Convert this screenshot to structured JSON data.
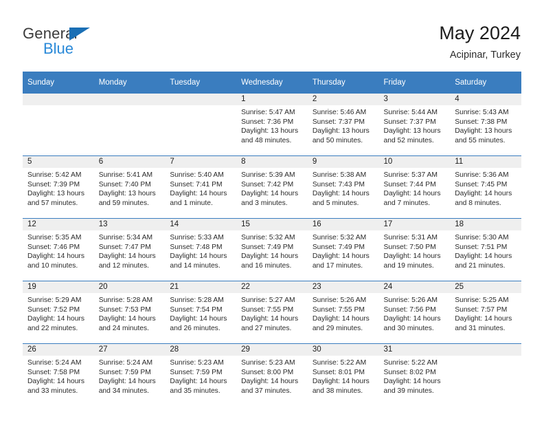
{
  "brand": {
    "name_top": "General",
    "name_bottom": "Blue",
    "triangle_color": "#1a6fb5",
    "blue_text_color": "#2989d8"
  },
  "header": {
    "title": "May 2024",
    "subtitle": "Acipinar, Turkey",
    "accent_color": "#3a7dbf",
    "daynum_band_color": "#efefef"
  },
  "calendar": {
    "weekday_headers": [
      "Sunday",
      "Monday",
      "Tuesday",
      "Wednesday",
      "Thursday",
      "Friday",
      "Saturday"
    ],
    "labels": {
      "sunrise": "Sunrise:",
      "sunset": "Sunset:",
      "daylight": "Daylight:"
    },
    "weeks": [
      [
        {
          "day": "",
          "empty": true
        },
        {
          "day": "",
          "empty": true
        },
        {
          "day": "",
          "empty": true
        },
        {
          "day": "1",
          "sunrise": "Sunrise: 5:47 AM",
          "sunset": "Sunset: 7:36 PM",
          "daylight1": "Daylight: 13 hours",
          "daylight2": "and 48 minutes."
        },
        {
          "day": "2",
          "sunrise": "Sunrise: 5:46 AM",
          "sunset": "Sunset: 7:37 PM",
          "daylight1": "Daylight: 13 hours",
          "daylight2": "and 50 minutes."
        },
        {
          "day": "3",
          "sunrise": "Sunrise: 5:44 AM",
          "sunset": "Sunset: 7:37 PM",
          "daylight1": "Daylight: 13 hours",
          "daylight2": "and 52 minutes."
        },
        {
          "day": "4",
          "sunrise": "Sunrise: 5:43 AM",
          "sunset": "Sunset: 7:38 PM",
          "daylight1": "Daylight: 13 hours",
          "daylight2": "and 55 minutes."
        }
      ],
      [
        {
          "day": "5",
          "sunrise": "Sunrise: 5:42 AM",
          "sunset": "Sunset: 7:39 PM",
          "daylight1": "Daylight: 13 hours",
          "daylight2": "and 57 minutes."
        },
        {
          "day": "6",
          "sunrise": "Sunrise: 5:41 AM",
          "sunset": "Sunset: 7:40 PM",
          "daylight1": "Daylight: 13 hours",
          "daylight2": "and 59 minutes."
        },
        {
          "day": "7",
          "sunrise": "Sunrise: 5:40 AM",
          "sunset": "Sunset: 7:41 PM",
          "daylight1": "Daylight: 14 hours",
          "daylight2": "and 1 minute."
        },
        {
          "day": "8",
          "sunrise": "Sunrise: 5:39 AM",
          "sunset": "Sunset: 7:42 PM",
          "daylight1": "Daylight: 14 hours",
          "daylight2": "and 3 minutes."
        },
        {
          "day": "9",
          "sunrise": "Sunrise: 5:38 AM",
          "sunset": "Sunset: 7:43 PM",
          "daylight1": "Daylight: 14 hours",
          "daylight2": "and 5 minutes."
        },
        {
          "day": "10",
          "sunrise": "Sunrise: 5:37 AM",
          "sunset": "Sunset: 7:44 PM",
          "daylight1": "Daylight: 14 hours",
          "daylight2": "and 7 minutes."
        },
        {
          "day": "11",
          "sunrise": "Sunrise: 5:36 AM",
          "sunset": "Sunset: 7:45 PM",
          "daylight1": "Daylight: 14 hours",
          "daylight2": "and 8 minutes."
        }
      ],
      [
        {
          "day": "12",
          "sunrise": "Sunrise: 5:35 AM",
          "sunset": "Sunset: 7:46 PM",
          "daylight1": "Daylight: 14 hours",
          "daylight2": "and 10 minutes."
        },
        {
          "day": "13",
          "sunrise": "Sunrise: 5:34 AM",
          "sunset": "Sunset: 7:47 PM",
          "daylight1": "Daylight: 14 hours",
          "daylight2": "and 12 minutes."
        },
        {
          "day": "14",
          "sunrise": "Sunrise: 5:33 AM",
          "sunset": "Sunset: 7:48 PM",
          "daylight1": "Daylight: 14 hours",
          "daylight2": "and 14 minutes."
        },
        {
          "day": "15",
          "sunrise": "Sunrise: 5:32 AM",
          "sunset": "Sunset: 7:49 PM",
          "daylight1": "Daylight: 14 hours",
          "daylight2": "and 16 minutes."
        },
        {
          "day": "16",
          "sunrise": "Sunrise: 5:32 AM",
          "sunset": "Sunset: 7:49 PM",
          "daylight1": "Daylight: 14 hours",
          "daylight2": "and 17 minutes."
        },
        {
          "day": "17",
          "sunrise": "Sunrise: 5:31 AM",
          "sunset": "Sunset: 7:50 PM",
          "daylight1": "Daylight: 14 hours",
          "daylight2": "and 19 minutes."
        },
        {
          "day": "18",
          "sunrise": "Sunrise: 5:30 AM",
          "sunset": "Sunset: 7:51 PM",
          "daylight1": "Daylight: 14 hours",
          "daylight2": "and 21 minutes."
        }
      ],
      [
        {
          "day": "19",
          "sunrise": "Sunrise: 5:29 AM",
          "sunset": "Sunset: 7:52 PM",
          "daylight1": "Daylight: 14 hours",
          "daylight2": "and 22 minutes."
        },
        {
          "day": "20",
          "sunrise": "Sunrise: 5:28 AM",
          "sunset": "Sunset: 7:53 PM",
          "daylight1": "Daylight: 14 hours",
          "daylight2": "and 24 minutes."
        },
        {
          "day": "21",
          "sunrise": "Sunrise: 5:28 AM",
          "sunset": "Sunset: 7:54 PM",
          "daylight1": "Daylight: 14 hours",
          "daylight2": "and 26 minutes."
        },
        {
          "day": "22",
          "sunrise": "Sunrise: 5:27 AM",
          "sunset": "Sunset: 7:55 PM",
          "daylight1": "Daylight: 14 hours",
          "daylight2": "and 27 minutes."
        },
        {
          "day": "23",
          "sunrise": "Sunrise: 5:26 AM",
          "sunset": "Sunset: 7:55 PM",
          "daylight1": "Daylight: 14 hours",
          "daylight2": "and 29 minutes."
        },
        {
          "day": "24",
          "sunrise": "Sunrise: 5:26 AM",
          "sunset": "Sunset: 7:56 PM",
          "daylight1": "Daylight: 14 hours",
          "daylight2": "and 30 minutes."
        },
        {
          "day": "25",
          "sunrise": "Sunrise: 5:25 AM",
          "sunset": "Sunset: 7:57 PM",
          "daylight1": "Daylight: 14 hours",
          "daylight2": "and 31 minutes."
        }
      ],
      [
        {
          "day": "26",
          "sunrise": "Sunrise: 5:24 AM",
          "sunset": "Sunset: 7:58 PM",
          "daylight1": "Daylight: 14 hours",
          "daylight2": "and 33 minutes."
        },
        {
          "day": "27",
          "sunrise": "Sunrise: 5:24 AM",
          "sunset": "Sunset: 7:59 PM",
          "daylight1": "Daylight: 14 hours",
          "daylight2": "and 34 minutes."
        },
        {
          "day": "28",
          "sunrise": "Sunrise: 5:23 AM",
          "sunset": "Sunset: 7:59 PM",
          "daylight1": "Daylight: 14 hours",
          "daylight2": "and 35 minutes."
        },
        {
          "day": "29",
          "sunrise": "Sunrise: 5:23 AM",
          "sunset": "Sunset: 8:00 PM",
          "daylight1": "Daylight: 14 hours",
          "daylight2": "and 37 minutes."
        },
        {
          "day": "30",
          "sunrise": "Sunrise: 5:22 AM",
          "sunset": "Sunset: 8:01 PM",
          "daylight1": "Daylight: 14 hours",
          "daylight2": "and 38 minutes."
        },
        {
          "day": "31",
          "sunrise": "Sunrise: 5:22 AM",
          "sunset": "Sunset: 8:02 PM",
          "daylight1": "Daylight: 14 hours",
          "daylight2": "and 39 minutes."
        },
        {
          "day": "",
          "empty": true
        }
      ]
    ]
  }
}
